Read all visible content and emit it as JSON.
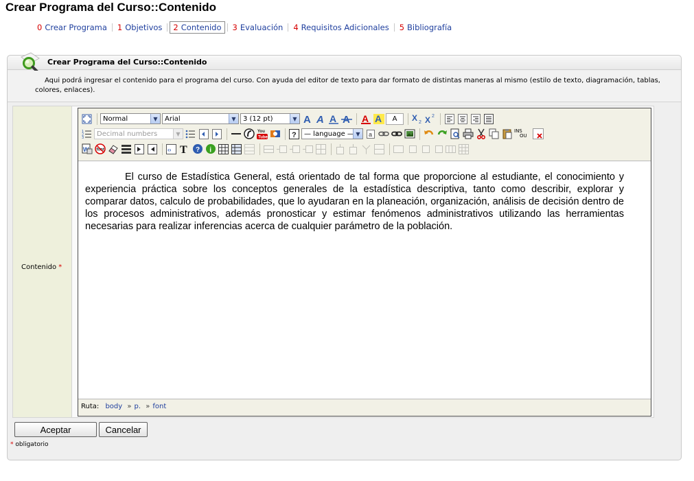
{
  "page": {
    "title": "Crear Programa del Curso::Contenido"
  },
  "steps": [
    {
      "num": "0",
      "label": "Crear Programa",
      "active": false
    },
    {
      "num": "1",
      "label": "Objetivos",
      "active": false
    },
    {
      "num": "2",
      "label": "Contenido",
      "active": true
    },
    {
      "num": "3",
      "label": "Evaluación",
      "active": false
    },
    {
      "num": "4",
      "label": "Requisitos Adicionales",
      "active": false
    },
    {
      "num": "5",
      "label": "Bibliografía",
      "active": false
    }
  ],
  "panel": {
    "title": "Crear Programa del Curso::Contenido",
    "description": "Aqui podrá ingresar el contenido para el programa del curso. Con ayuda del editor de texto para dar formato de distintas maneras al mismo (estilo de texto, diagramación, tablas, colores, enlaces)."
  },
  "form": {
    "field_label": "Contenido",
    "required_mark": "*"
  },
  "editor": {
    "format_select": "Normal",
    "font_select": "Arial",
    "size_select": "3 (12 pt)",
    "list_style_select": "Decimal numbers",
    "language_select": "— language —",
    "text_sample": "A",
    "ins_label": "INS",
    "ou_label": "OU",
    "content": "El curso de Estadística General, está orientado de tal forma que  proporcione al estudiante, el conocimiento y experiencia práctica sobre los  conceptos generales de la estadística descriptiva, tanto como describir, explorar y comparar datos, calculo de probabilidades, que lo ayudaran en la planeación, organización, análisis de decisión dentro de los procesos administrativos, además pronosticar y estimar fenómenos administrativos utilizando las herramientas necesarias para realizar inferencias acerca de cualquier parámetro de la población.",
    "status": {
      "label": "Ruta:",
      "path": [
        "body",
        "p.",
        "font"
      ],
      "sep": "»"
    }
  },
  "buttons": {
    "accept": "Aceptar",
    "cancel": "Cancelar"
  },
  "footer": {
    "required_note": "obligatorio"
  },
  "colors": {
    "link": "#1f3f9e",
    "step_number": "#d60000",
    "label_bg": "#eef0dc",
    "toolbar_bg": "#f2f1e6"
  }
}
